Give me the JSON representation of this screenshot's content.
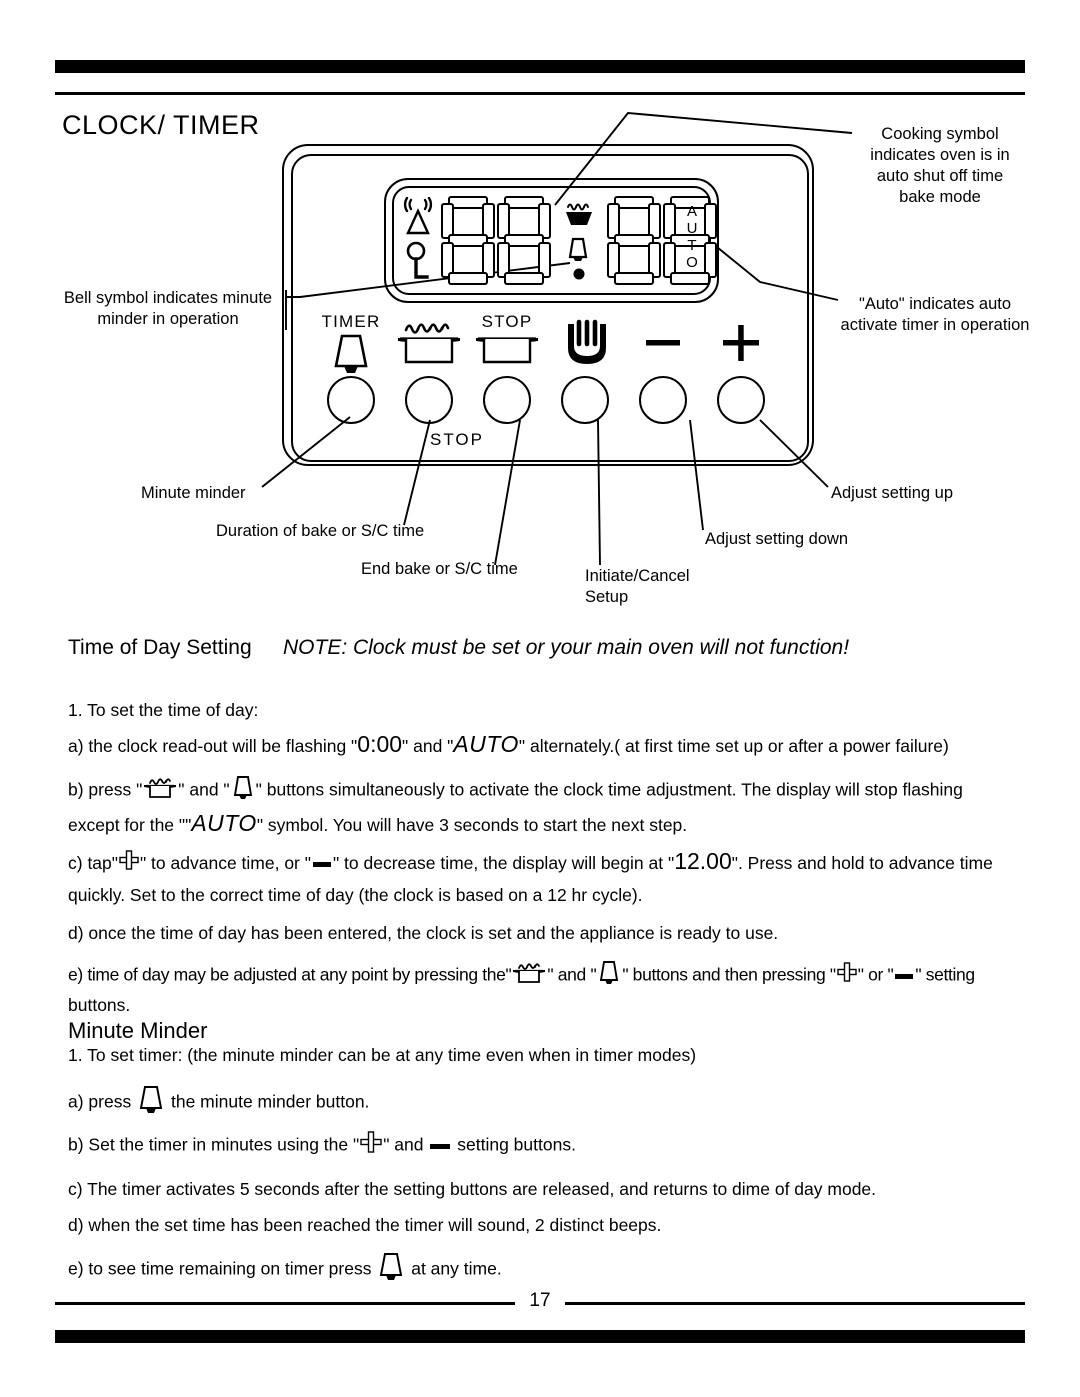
{
  "document": {
    "title": "CLOCK/ TIMER",
    "page_number": "17"
  },
  "diagram": {
    "name": "clock-timer-control-panel",
    "display": {
      "digits": "88:88",
      "auto_label": "AUTO",
      "indicator_icons": [
        "antenna-icon",
        "key-icon",
        "cooking-pot-steam-icon",
        "bell-icon",
        "decimal-dot-icon"
      ]
    },
    "buttons": [
      {
        "caption": "TIMER",
        "icon": "bell-icon",
        "name": "timer-button"
      },
      {
        "caption": "",
        "icon": "pot-steam-icon",
        "name": "duration-bake-button"
      },
      {
        "caption": "STOP",
        "icon": "pot-icon",
        "name": "end-bake-button"
      },
      {
        "caption": "",
        "icon": "hand-heat-icon",
        "name": "initiate-cancel-button"
      },
      {
        "caption": "",
        "icon": "minus-icon",
        "name": "adjust-down-button"
      },
      {
        "caption": "",
        "icon": "plus-icon",
        "name": "adjust-up-button"
      }
    ],
    "sub_label": "STOP",
    "callouts": {
      "cooking_symbol": "Cooking symbol\nindicates oven is in\nauto shut off time\nbake mode",
      "auto_indicates": "\"Auto\" indicates auto\nactivate timer in operation",
      "bell_symbol": "Bell symbol indicates minute\nminder in operation",
      "minute_minder": "Minute minder",
      "duration_bake": "Duration of bake or S/C time",
      "end_bake": "End bake or S/C  time",
      "initiate_cancel": "Initiate/Cancel\nSetup",
      "adjust_down": "Adjust setting down",
      "adjust_up": "Adjust setting up"
    }
  },
  "sections": {
    "time_of_day": {
      "heading": "Time of Day Setting",
      "note": "NOTE: Clock must be set or your main oven will not function!",
      "item1": "1. To set the time of day:",
      "a_pre": "a) the clock read-out will be flashing \"",
      "a_clock": "0:00",
      "a_mid": "\" and \"",
      "a_auto": "AUTO",
      "a_post": "\" alternately.( at first time set up or after a power failure)",
      "b_pre": "b) press \"",
      "b_mid1": "\" and \"",
      "b_mid2": "\" buttons simultaneously to activate the clock time adjustment. The display will stop flashing",
      "b_line2_pre": "except for the \"\"",
      "b_line2_auto": "AUTO",
      "b_line2_post": "\" symbol. You will have 3 seconds to start the next step.",
      "c_pre": "c) tap\"",
      "c_mid1": "\" to advance time, or \"",
      "c_mid2": "\" to decrease time, the display will begin at \"",
      "c_value": "12.00",
      "c_post": "\". Press and hold to advance time",
      "c_line2": "quickly. Set to the correct time of day (the clock is based on a 12 hr cycle).",
      "d": "d) once the time of day has been entered, the clock is set and the appliance is ready to use.",
      "e_pre": "e) time of day may be adjusted at any point by pressing the\"",
      "e_mid1": "\" and \"",
      "e_mid2": "\" buttons and then pressing \"",
      "e_mid3": "\" or \"",
      "e_post": "\" setting",
      "e_line2": "buttons."
    },
    "minute_minder": {
      "heading": "Minute Minder",
      "item1": "1. To set timer:  (the minute minder can be at any time even when in timer modes)",
      "a_pre": "a) press",
      "a_post": "the minute minder button.",
      "b_pre": "b) Set the timer in minutes using the \"",
      "b_mid": "\" and",
      "b_post": "setting buttons.",
      "c": "c) The timer activates 5 seconds  after the setting buttons are released, and returns to dime of day mode.",
      "d": "d) when the set time has been reached the timer will sound, 2 distinct beeps.",
      "e_pre": "e) to see time remaining on timer press",
      "e_post": "at any time."
    }
  },
  "colors": {
    "ink": "#000000",
    "paper": "#ffffff"
  }
}
